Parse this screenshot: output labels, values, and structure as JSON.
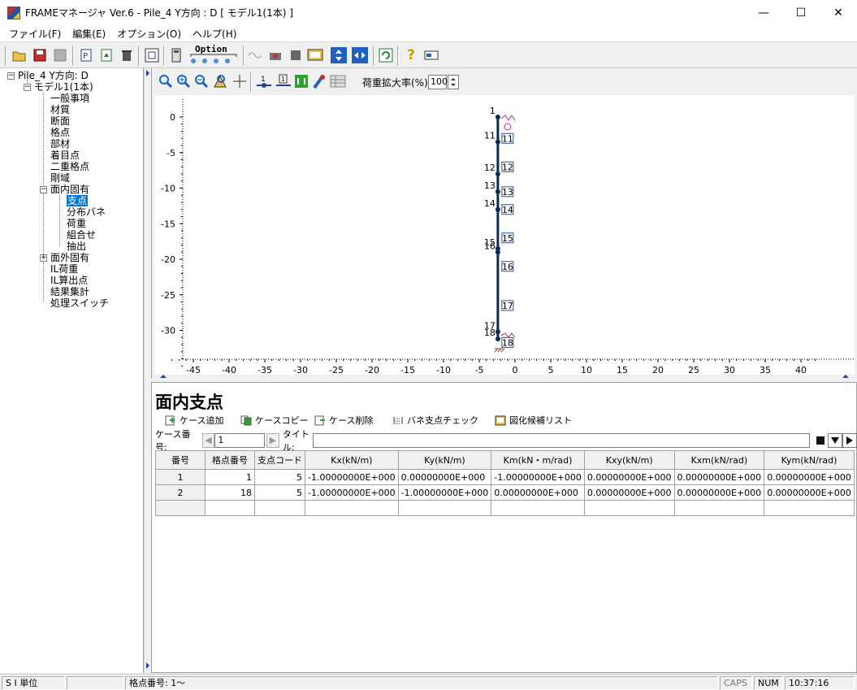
{
  "window": {
    "title": "FRAMEマネージャ Ver.6 - Pile_4 Y方向 : D [ モデル1(1本) ]",
    "minimize": "—",
    "maximize": "☐",
    "close": "✕"
  },
  "menu": [
    "ファイル(F)",
    "編集(E)",
    "オプション(O)",
    "ヘルプ(H)"
  ],
  "toolbar": {
    "option_label": "Option"
  },
  "tree": {
    "root": "Pile_4 Y方向: D",
    "model": "モデル1(1本)",
    "items": [
      "一般事項",
      "材質",
      "断面",
      "格点",
      "部材",
      "着目点",
      "二重格点",
      "剛域",
      "面内固有"
    ],
    "sub_items": [
      "支点",
      "分布バネ",
      "荷重",
      "組合せ",
      "抽出"
    ],
    "after": [
      "面外固有",
      "IL荷重",
      "IL算出点",
      "結果集計",
      "処理スイッチ"
    ]
  },
  "view": {
    "load_scale_label": "荷重拡大率(%)",
    "load_scale_value": "100",
    "y_ticks": [
      "0",
      "-5",
      "-10",
      "-15",
      "-20",
      "-25",
      "-30"
    ],
    "x_ticks": [
      "-45",
      "-40",
      "-35",
      "-30",
      "-25",
      "-20",
      "-15",
      "-10",
      "-5",
      "0",
      "5",
      "10",
      "15",
      "20",
      "25",
      "30",
      "35",
      "40"
    ],
    "nodes": [
      {
        "label": "1",
        "y": 0
      },
      {
        "label": "11",
        "y": -3.5
      },
      {
        "label": "12",
        "y": -8
      },
      {
        "label": "13",
        "y": -10.5
      },
      {
        "label": "14",
        "y": -13
      },
      {
        "label": "15",
        "y": -18.5
      },
      {
        "label": "16",
        "y": -19
      },
      {
        "label": "17",
        "y": -30.2
      },
      {
        "label": "18",
        "y": -31.2
      }
    ],
    "members": [
      {
        "label": "11",
        "y": -3
      },
      {
        "label": "12",
        "y": -7
      },
      {
        "label": "13",
        "y": -10.5
      },
      {
        "label": "14",
        "y": -13
      },
      {
        "label": "15",
        "y": -17
      },
      {
        "label": "16",
        "y": -21
      },
      {
        "label": "17",
        "y": -26.5
      },
      {
        "label": "18",
        "y": -31.7
      }
    ]
  },
  "panel": {
    "heading": "面内支点",
    "buttons": [
      "ケース追加",
      "ケースコピー",
      "ケース削除",
      "バネ支点チェック",
      "図化候補リスト"
    ],
    "case_label": "ケース番号:",
    "case_value": "1",
    "title_label": "タイトル:",
    "title_value": ""
  },
  "table": {
    "headers": [
      "番号",
      "格点番号",
      "支点コード",
      "Kx(kN/m)",
      "Ky(kN/m)",
      "Km(kN・m/rad)",
      "Kxy(kN/m)",
      "Kxm(kN/rad)",
      "Kym(kN/rad)"
    ],
    "rows": [
      [
        "1",
        "1",
        "5",
        "-1.00000000E+000",
        "0.00000000E+000",
        "-1.00000000E+000",
        "0.00000000E+000",
        "0.00000000E+000",
        "0.00000000E+000"
      ],
      [
        "2",
        "18",
        "5",
        "-1.00000000E+000",
        "-1.00000000E+000",
        "0.00000000E+000",
        "0.00000000E+000",
        "0.00000000E+000",
        "0.00000000E+000"
      ]
    ]
  },
  "status": {
    "units": "S I 単位",
    "blank": "",
    "node_info": "格点番号: 1〜",
    "caps": "CAPS",
    "num": "NUM",
    "time": "10:37:16"
  }
}
